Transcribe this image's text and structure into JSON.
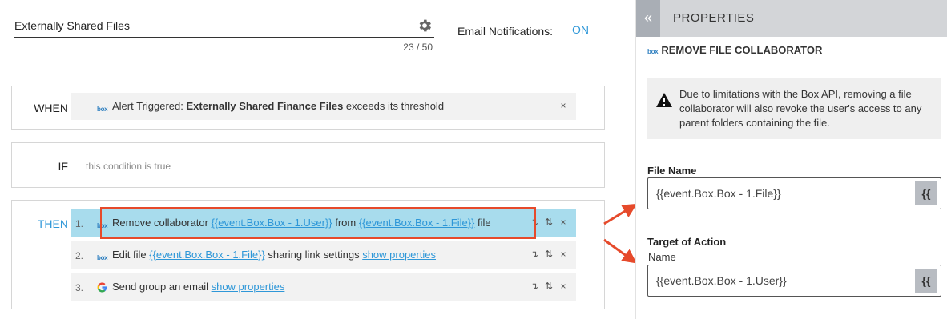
{
  "rule": {
    "name": "Externally Shared Files",
    "char_count": "23 / 50",
    "email_label": "Email Notifications:",
    "email_state": "ON"
  },
  "when": {
    "label": "WHEN",
    "prefix": "Alert Triggered: ",
    "bold": "Externally Shared Finance Files",
    "suffix": " exceeds its threshold"
  },
  "if_section": {
    "label": "IF",
    "text": "this condition is true"
  },
  "then": {
    "label": "THEN",
    "actions": [
      {
        "num": "1.",
        "t1": "Remove collaborator ",
        "l1": "{{event.Box.Box - 1.User}}",
        "t2": " from ",
        "l2": "{{event.Box.Box - 1.File}}",
        "t3": " file"
      },
      {
        "num": "2.",
        "t1": "Edit file ",
        "l1": "{{event.Box.Box - 1.File}}",
        "t2": " sharing link settings ",
        "l2": "show properties"
      },
      {
        "num": "3.",
        "t1": "Send group an email ",
        "l1": "show properties"
      }
    ]
  },
  "properties": {
    "header": "PROPERTIES",
    "collapse": "«",
    "action_title": "REMOVE FILE COLLABORATOR",
    "warning": "Due to limitations with the Box API, removing a file collaborator will also revoke the user's access to any parent folders containing the file.",
    "file_label": "File Name",
    "file_value": "{{event.Box.Box - 1.File}}",
    "target_label": "Target of Action",
    "name_label": "Name",
    "user_value": "{{event.Box.Box - 1.User}}",
    "brace": "{{"
  },
  "icons": {
    "box_logo": "box",
    "close": "×",
    "move_down": "↴",
    "reorder": "⇅"
  },
  "colors": {
    "accent": "#2e97d8",
    "active_row": "#a8dced",
    "highlight": "#e64a2b"
  }
}
